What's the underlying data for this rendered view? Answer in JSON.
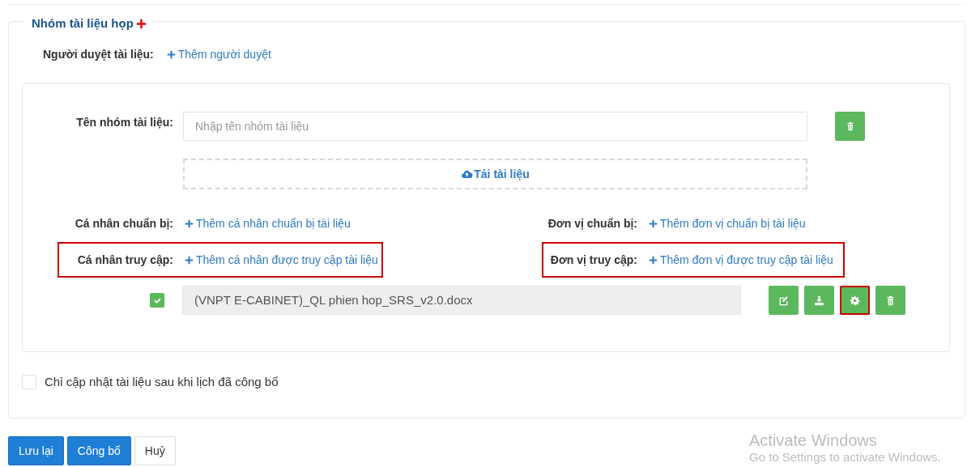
{
  "group": {
    "legend": "Nhóm tài liệu họp",
    "reviewer": {
      "label": "Người duyệt tài liệu:",
      "link": "Thêm người duyệt"
    },
    "name_field": {
      "label": "Tên nhóm tài liệu:",
      "placeholder": "Nhập tên nhóm tài liệu"
    },
    "upload": {
      "label": "Tải tài liệu"
    },
    "assignments": [
      {
        "label": "Cá nhân chuẩn bị:",
        "link": "Thêm cá nhân chuẩn bị tài liệu",
        "highlighted": false
      },
      {
        "label": "Đơn vị chuẩn bị:",
        "link": "Thêm đơn vị chuẩn bị tài liệu",
        "highlighted": false
      },
      {
        "label": "Cá nhân truy cập:",
        "link": "Thêm cá nhân được truy cập tài liệu",
        "highlighted": true
      },
      {
        "label": "Đơn vị truy cập:",
        "link": "Thêm đơn vị được truy cập tài liệu",
        "highlighted": true
      }
    ],
    "file": {
      "checked": true,
      "name": "(VNPT E-CABINET)_QL phien hop_SRS_v2.0.docx",
      "actions": [
        {
          "kind": "edit",
          "highlighted": false
        },
        {
          "kind": "download",
          "highlighted": false
        },
        {
          "kind": "settings",
          "highlighted": true
        },
        {
          "kind": "delete",
          "highlighted": false
        }
      ]
    },
    "publish_only": {
      "label": "Chỉ cập nhật tài liệu sau khi lịch đã công bố",
      "checked": false
    }
  },
  "buttons": [
    {
      "label": "Lưu lại",
      "kind": "primary"
    },
    {
      "label": "Công bố",
      "kind": "primary"
    },
    {
      "label": "Huỷ",
      "kind": "secondary"
    }
  ],
  "os_notice": {
    "title": "Activate Windows",
    "subtitle": "Go to Settings to activate Windows."
  }
}
